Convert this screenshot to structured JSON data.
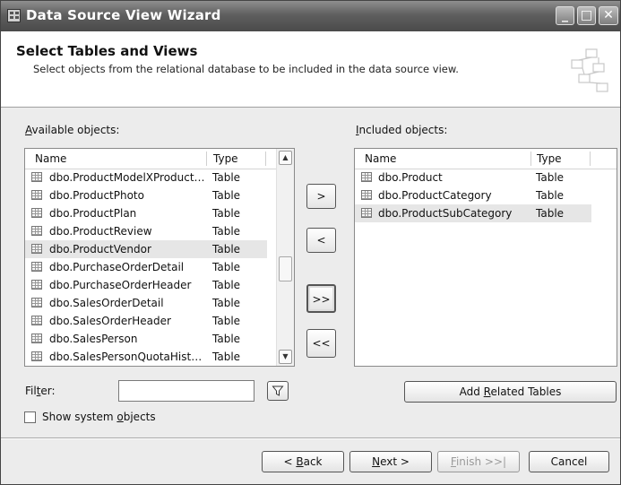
{
  "window": {
    "title": "Data Source View Wizard",
    "minimize": "_",
    "maximize": "□",
    "close": "✕"
  },
  "header": {
    "title": "Select Tables and Views",
    "subtitle": "Select objects from the relational database to be included in the data source view."
  },
  "available": {
    "label_prefix": "",
    "label_access": "A",
    "label_rest": "vailable objects:",
    "col_name": "Name",
    "col_type": "Type",
    "rows": [
      {
        "name": "dbo.ProductModelXProduct…",
        "type": "Table"
      },
      {
        "name": "dbo.ProductPhoto",
        "type": "Table"
      },
      {
        "name": "dbo.ProductPlan",
        "type": "Table"
      },
      {
        "name": "dbo.ProductReview",
        "type": "Table"
      },
      {
        "name": "dbo.ProductVendor",
        "type": "Table"
      },
      {
        "name": "dbo.PurchaseOrderDetail",
        "type": "Table"
      },
      {
        "name": "dbo.PurchaseOrderHeader",
        "type": "Table"
      },
      {
        "name": "dbo.SalesOrderDetail",
        "type": "Table"
      },
      {
        "name": "dbo.SalesOrderHeader",
        "type": "Table"
      },
      {
        "name": "dbo.SalesPerson",
        "type": "Table"
      },
      {
        "name": "dbo.SalesPersonQuotaHist…",
        "type": "Table"
      }
    ]
  },
  "included": {
    "label_access": "I",
    "label_rest": "ncluded objects:",
    "col_name": "Name",
    "col_type": "Type",
    "rows": [
      {
        "name": "dbo.Product",
        "type": "Table"
      },
      {
        "name": "dbo.ProductCategory",
        "type": "Table"
      },
      {
        "name": "dbo.ProductSubCategory",
        "type": "Table"
      }
    ]
  },
  "transfer": {
    "add": ">",
    "remove": "<",
    "add_all": ">>",
    "remove_all": "<<"
  },
  "filter": {
    "label_pre": "Fil",
    "label_access": "t",
    "label_post": "er:",
    "value": ""
  },
  "show_system": {
    "label_pre": "Show system ",
    "label_access": "o",
    "label_post": "bjects",
    "checked": false
  },
  "add_related": {
    "pre": "Add ",
    "access": "R",
    "post": "elated Tables"
  },
  "footer": {
    "back_pre": "< ",
    "back_access": "B",
    "back_post": "ack",
    "next_access": "N",
    "next_post": "ext >",
    "finish_access": "F",
    "finish_post": "inish >>|",
    "cancel": "Cancel"
  }
}
